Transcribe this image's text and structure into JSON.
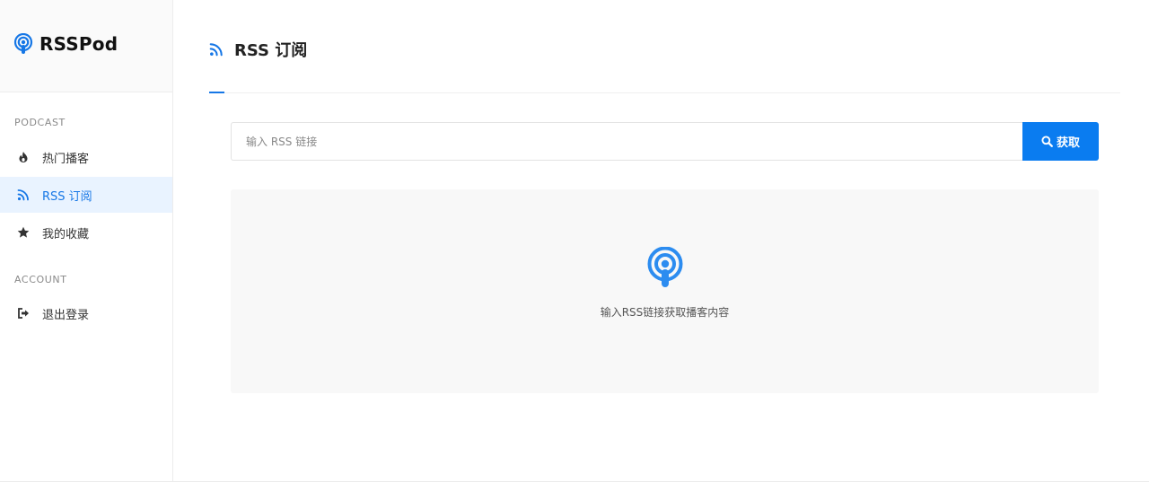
{
  "brand": {
    "name": "RSSPod",
    "icon": "podcast-icon"
  },
  "sidebar": {
    "sections": {
      "podcast": "PODCAST",
      "account": "ACCOUNT"
    },
    "items": [
      {
        "label": "热门播客",
        "icon": "fire-icon"
      },
      {
        "label": "RSS 订阅",
        "icon": "rss-icon",
        "active": true
      },
      {
        "label": "我的收藏",
        "icon": "star-icon"
      },
      {
        "label": "退出登录",
        "icon": "sign-out-icon"
      }
    ]
  },
  "page": {
    "title": "RSS 订阅",
    "title_icon": "rss-icon"
  },
  "search": {
    "placeholder": "输入 RSS 链接",
    "value": "",
    "button_label": "获取",
    "button_icon": "search-icon"
  },
  "empty_state": {
    "icon": "podcast-icon",
    "message": "输入RSS链接获取播客内容"
  },
  "colors": {
    "accent": "#0a7cf0",
    "active_bg": "#e9f3ff",
    "panel_bg": "#f8f8f8"
  }
}
